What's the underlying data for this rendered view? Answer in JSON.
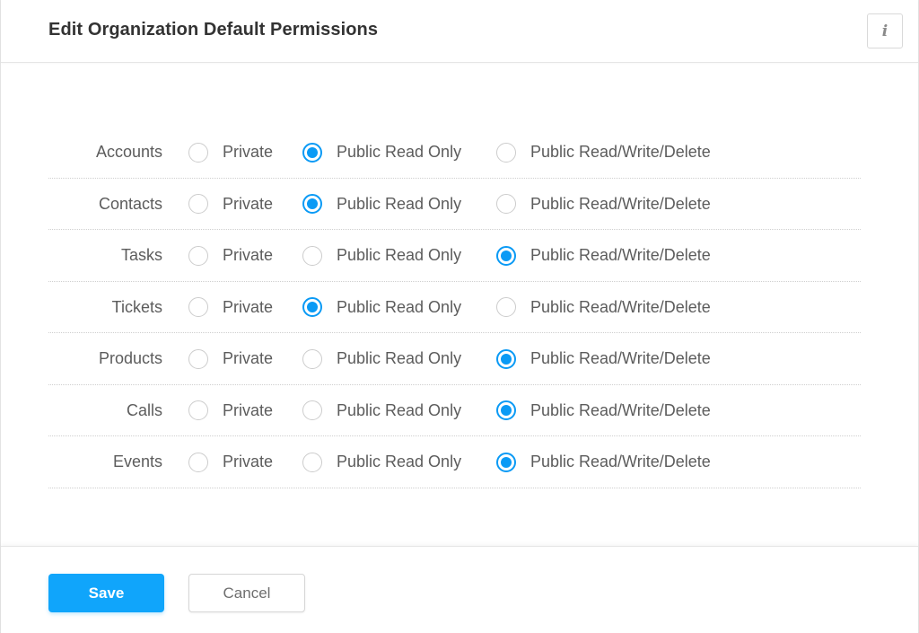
{
  "dialog": {
    "title": "Edit Organization Default Permissions",
    "info_icon": "i"
  },
  "options": [
    "Private",
    "Public Read Only",
    "Public Read/Write/Delete"
  ],
  "colors": {
    "accent": "#0a9af5",
    "save_button": "#10a5fb"
  },
  "permissions": [
    {
      "module": "Accounts",
      "selected": "Public Read Only"
    },
    {
      "module": "Contacts",
      "selected": "Public Read Only"
    },
    {
      "module": "Tasks",
      "selected": "Public Read/Write/Delete"
    },
    {
      "module": "Tickets",
      "selected": "Public Read Only"
    },
    {
      "module": "Products",
      "selected": "Public Read/Write/Delete"
    },
    {
      "module": "Calls",
      "selected": "Public Read/Write/Delete"
    },
    {
      "module": "Events",
      "selected": "Public Read/Write/Delete"
    }
  ],
  "footer": {
    "save_label": "Save",
    "cancel_label": "Cancel"
  }
}
